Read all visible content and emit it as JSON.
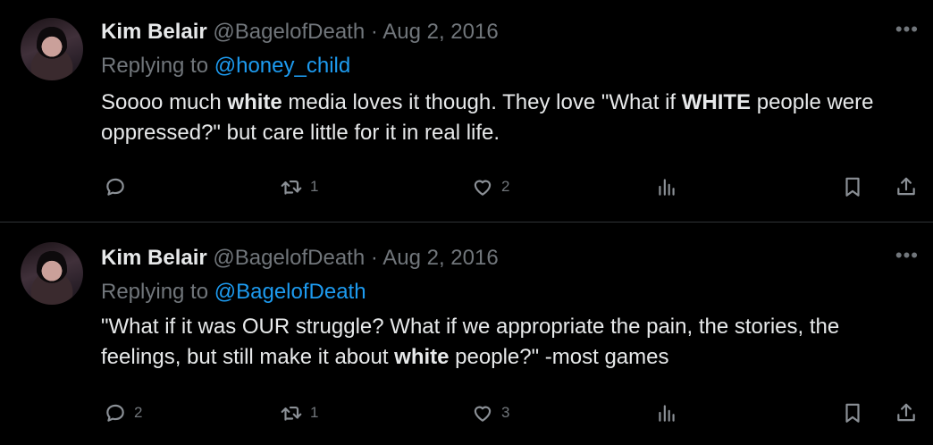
{
  "tweets": [
    {
      "author_name": "Kim Belair",
      "handle": "@BagelofDeath",
      "separator": "·",
      "date": "Aug 2, 2016",
      "more": "•••",
      "replying_prefix": "Replying to ",
      "replying_to": "@honey_child",
      "body_segments": [
        {
          "text": "Soooo much ",
          "bold": false
        },
        {
          "text": "white",
          "bold": true
        },
        {
          "text": " media loves it though. They love \"What if ",
          "bold": false
        },
        {
          "text": "WHITE",
          "bold": true
        },
        {
          "text": " people were oppressed?\" but care little for it in real life.",
          "bold": false
        }
      ],
      "reply_count": "",
      "retweet_count": "1",
      "like_count": "2"
    },
    {
      "author_name": "Kim Belair",
      "handle": "@BagelofDeath",
      "separator": "·",
      "date": "Aug 2, 2016",
      "more": "•••",
      "replying_prefix": "Replying to ",
      "replying_to": "@BagelofDeath",
      "body_segments": [
        {
          "text": "\"What if it was OUR struggle? What if we appropriate the pain, the stories, the feelings, but still make it about ",
          "bold": false
        },
        {
          "text": "white",
          "bold": true
        },
        {
          "text": " people?\" -most games",
          "bold": false
        }
      ],
      "reply_count": "2",
      "retweet_count": "1",
      "like_count": "3"
    }
  ],
  "icons": {
    "reply": "reply-icon",
    "retweet": "retweet-icon",
    "like": "heart-icon",
    "views": "views-icon",
    "bookmark": "bookmark-icon",
    "share": "share-icon"
  },
  "colors": {
    "background": "#000000",
    "text": "#e7e9ea",
    "muted": "#71767b",
    "link": "#1d9bf0",
    "divider": "#2f3336"
  }
}
